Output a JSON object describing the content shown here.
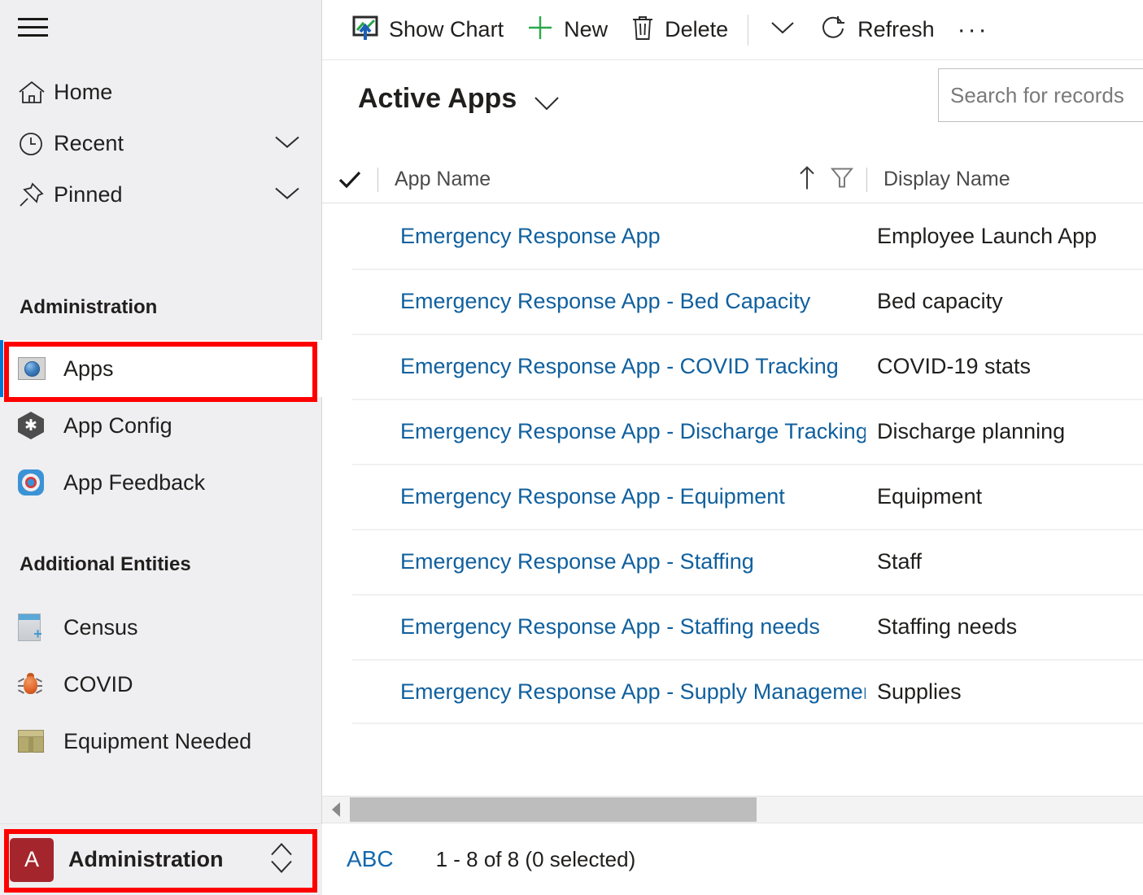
{
  "sidebar": {
    "menu_icon": "hamburger-icon",
    "nav": [
      {
        "label": "Home",
        "icon": "home-icon",
        "chevron": false
      },
      {
        "label": "Recent",
        "icon": "clock-icon",
        "chevron": true
      },
      {
        "label": "Pinned",
        "icon": "pin-icon",
        "chevron": true
      }
    ],
    "groups": [
      {
        "title": "Administration",
        "items": [
          {
            "label": "Apps",
            "icon": "globe-window-icon",
            "selected": true
          },
          {
            "label": "App Config",
            "icon": "hexagon-gear-icon",
            "selected": false
          },
          {
            "label": "App Feedback",
            "icon": "life-ring-icon",
            "selected": false
          }
        ]
      },
      {
        "title": "Additional Entities",
        "items": [
          {
            "label": "Census",
            "icon": "document-plus-icon",
            "selected": false
          },
          {
            "label": "COVID",
            "icon": "bug-icon",
            "selected": false
          },
          {
            "label": "Equipment Needed",
            "icon": "box-icon",
            "selected": false
          }
        ]
      }
    ],
    "area_switcher": {
      "badge": "A",
      "label": "Administration",
      "chevron_icon": "chevron-up-down-icon"
    }
  },
  "commandbar": {
    "show_chart": "Show Chart",
    "new": "New",
    "delete": "Delete",
    "refresh": "Refresh",
    "overflow": "···"
  },
  "view": {
    "title": "Active Apps",
    "title_chevron_icon": "chevron-down-icon",
    "search": {
      "placeholder": "Search for records",
      "value": ""
    }
  },
  "grid": {
    "columns": {
      "select_all_icon": "checkmark-icon",
      "app_name": "App Name",
      "display_name": "Display Name",
      "sort_icon": "sort-ascending-icon",
      "filter_icon": "filter-funnel-icon"
    },
    "rows": [
      {
        "app_name": "Emergency Response App",
        "display_name": "Employee Launch App"
      },
      {
        "app_name": "Emergency Response App - Bed Capacity",
        "display_name": "Bed capacity"
      },
      {
        "app_name": "Emergency Response App - COVID Tracking",
        "display_name": "COVID-19 stats"
      },
      {
        "app_name": "Emergency Response App - Discharge Tracking.",
        "display_name": "Discharge planning"
      },
      {
        "app_name": "Emergency Response App - Equipment",
        "display_name": "Equipment"
      },
      {
        "app_name": "Emergency Response App - Staffing",
        "display_name": "Staff"
      },
      {
        "app_name": "Emergency Response App - Staffing needs",
        "display_name": "Staffing needs"
      },
      {
        "app_name": "Emergency Response App - Supply Management",
        "display_name": "Supplies"
      }
    ]
  },
  "footer": {
    "alpha_filter": "ABC",
    "record_count": "1 - 8 of 8 (0 selected)"
  },
  "colors": {
    "link": "#10609e",
    "accent": "#0078d4",
    "area_badge": "#a4262c",
    "annotation": "#ff0000",
    "sidebar_bg": "#efeff1"
  }
}
